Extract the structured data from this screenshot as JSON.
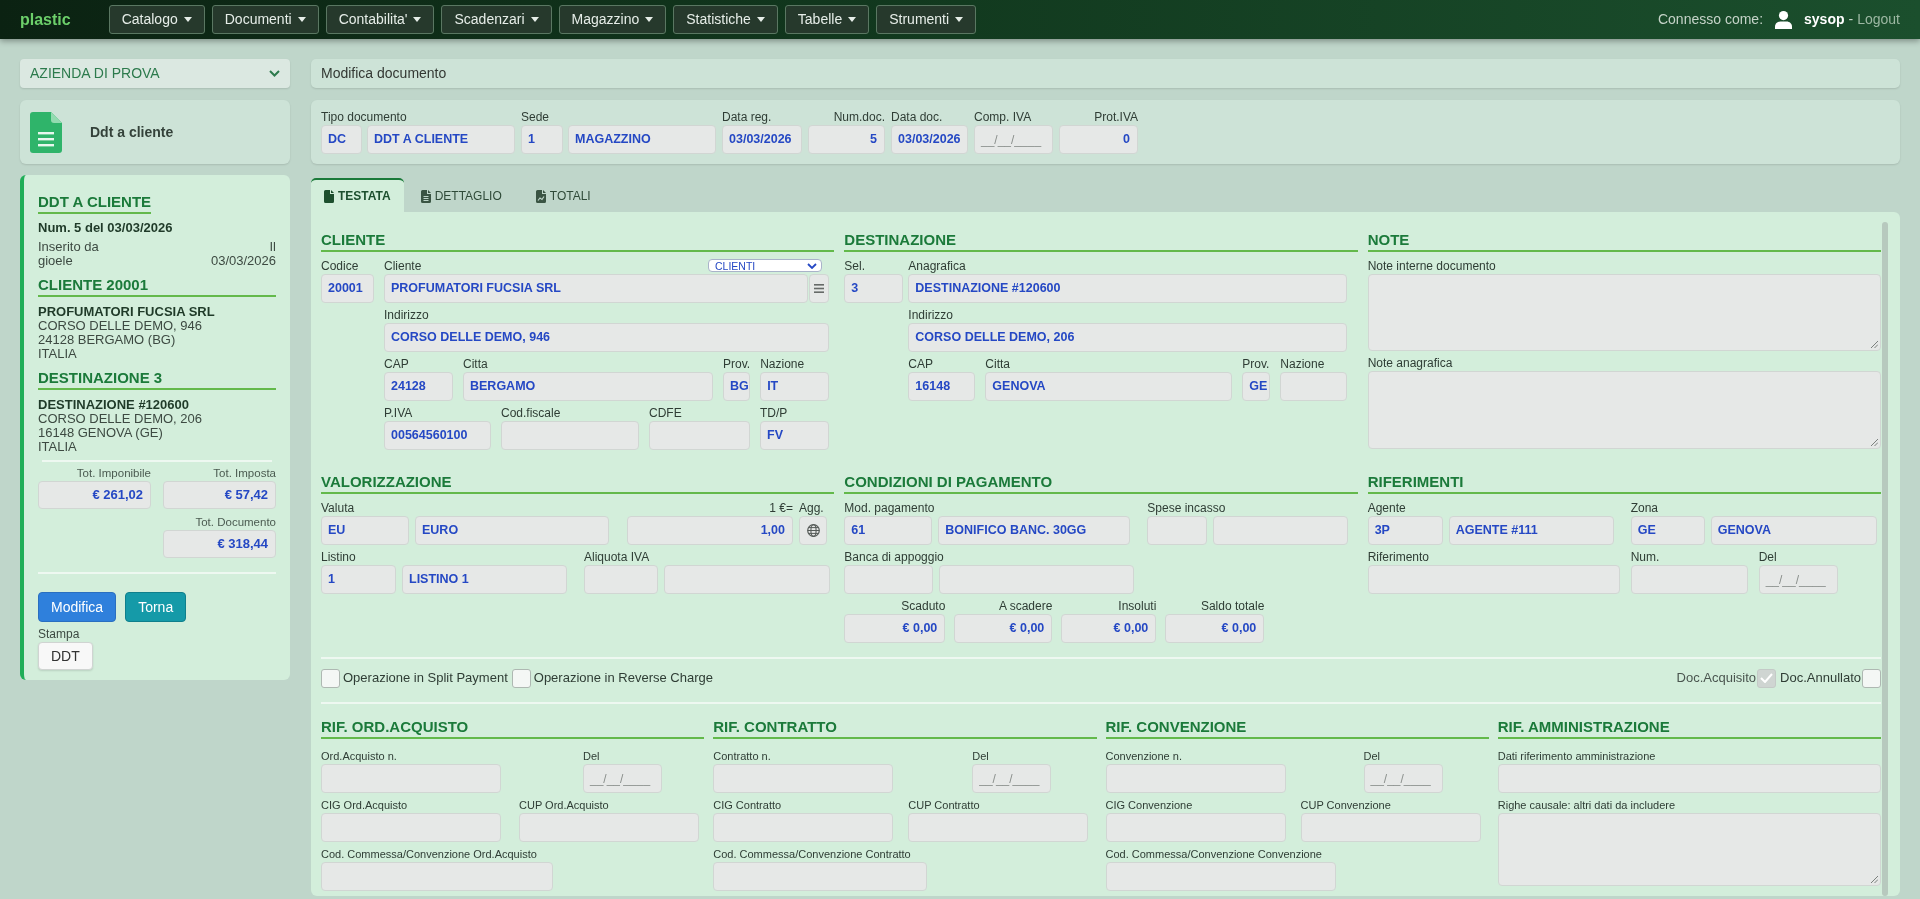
{
  "navbar": {
    "logo": "plastic",
    "menus": [
      "Catalogo",
      "Documenti",
      "Contabilita'",
      "Scadenzari",
      "Magazzino",
      "Statistiche",
      "Tabelle",
      "Strumenti"
    ],
    "user_prompt": "Connesso come:",
    "user": "sysop",
    "separator": "-",
    "logout": "Logout"
  },
  "company_select": {
    "value": "AZIENDA DI PROVA"
  },
  "document_type_card": {
    "title": "Ddt a cliente"
  },
  "summary": {
    "title": "DDT A CLIENTE",
    "number": "Num. 5 del 03/03/2026",
    "inserted_by": "Inserito da gioele",
    "inserted_on": "Il 03/03/2026",
    "sections": [
      {
        "title": "CLIENTE 20001",
        "name": "PROFUMATORI FUCSIA SRL",
        "lines": [
          "CORSO DELLE DEMO, 946",
          "24128 BERGAMO (BG)",
          "ITALIA"
        ]
      },
      {
        "title": "DESTINAZIONE 3",
        "name": "DESTINAZIONE #120600",
        "lines": [
          "CORSO DELLE DEMO, 206",
          "16148 GENOVA (GE)",
          "ITALIA"
        ]
      }
    ],
    "totals": [
      {
        "label": "Tot. Imponibile",
        "value": "€ 261,02"
      },
      {
        "label": "Tot. Imposta",
        "value": "€ 57,42"
      },
      {
        "label": "Tot. Documento",
        "value": "€ 318,44"
      }
    ],
    "buttons": [
      {
        "label": "Modifica",
        "kind": "primary"
      },
      {
        "label": "Torna",
        "kind": "info"
      }
    ],
    "print_label": "Stampa",
    "print_buttons": [
      {
        "label": "DDT"
      }
    ]
  },
  "page_title": "Modifica documento",
  "header_fields": [
    {
      "label": "Tipo documento",
      "inputs": [
        {
          "kind": "text",
          "value": "DC"
        },
        {
          "kind": "text",
          "value": "DDT A CLIENTE"
        }
      ]
    },
    {
      "label": "Sede",
      "inputs": [
        {
          "kind": "text",
          "value": "1"
        },
        {
          "kind": "text",
          "value": "MAGAZZINO"
        }
      ]
    },
    {
      "label": "Data reg.",
      "inputs": [
        {
          "kind": "date",
          "value": "03/03/2026"
        }
      ]
    },
    {
      "label": "Num.doc.",
      "inputs": [
        {
          "kind": "number",
          "value": "5"
        }
      ]
    },
    {
      "label": "Data doc.",
      "inputs": [
        {
          "kind": "date",
          "value": "03/03/2026"
        }
      ]
    },
    {
      "label": "Comp. IVA",
      "inputs": [
        {
          "kind": "date",
          "placeholder": "__/__/____"
        }
      ]
    },
    {
      "label": "Prot.IVA",
      "inputs": [
        {
          "kind": "number",
          "value": "0"
        }
      ]
    }
  ],
  "tabs": [
    {
      "label": "TESTATA",
      "selected": true
    },
    {
      "label": "DETTAGLIO",
      "selected": false
    },
    {
      "label": "TOTALI",
      "selected": false
    }
  ],
  "form": {
    "sections": [
      {
        "title": "CLIENTE",
        "fields": [
          {
            "label": "Codice",
            "inputs": [
              {
                "kind": "text",
                "value": "20001"
              }
            ]
          },
          {
            "label": "Cliente",
            "filter": {
              "value": "CLIENTI"
            },
            "inputs": [
              {
                "kind": "text",
                "value": "PROFUMATORI FUCSIA SRL"
              },
              {
                "kind": "button"
              }
            ]
          },
          {
            "label": "Indirizzo",
            "inputs": [
              {
                "kind": "text",
                "value": "CORSO DELLE DEMO, 946"
              }
            ]
          },
          {
            "label": "CAP",
            "inputs": [
              {
                "kind": "text",
                "value": "24128"
              }
            ]
          },
          {
            "label": "Citta",
            "inputs": [
              {
                "kind": "text",
                "value": "BERGAMO"
              }
            ]
          },
          {
            "label": "Prov.",
            "inputs": [
              {
                "kind": "text",
                "value": "BG"
              }
            ]
          },
          {
            "label": "Nazione",
            "inputs": [
              {
                "kind": "text",
                "value": "IT"
              }
            ]
          },
          {
            "label": "P.IVA",
            "inputs": [
              {
                "kind": "text",
                "value": "00564560100"
              }
            ]
          },
          {
            "label": "Cod.fiscale",
            "inputs": [
              {
                "kind": "text"
              }
            ]
          },
          {
            "label": "CDFE",
            "inputs": [
              {
                "kind": "text"
              }
            ]
          },
          {
            "label": "TD/P",
            "inputs": [
              {
                "kind": "text",
                "value": "FV"
              }
            ]
          }
        ]
      },
      {
        "title": "DESTINAZIONE",
        "fields": [
          {
            "label": "Sel.",
            "inputs": [
              {
                "kind": "text",
                "value": "3"
              }
            ]
          },
          {
            "label": "Anagrafica",
            "inputs": [
              {
                "kind": "text",
                "value": "DESTINAZIONE #120600"
              }
            ]
          },
          {
            "label": "Indirizzo",
            "inputs": [
              {
                "kind": "text",
                "value": "CORSO DELLE DEMO, 206"
              }
            ]
          },
          {
            "label": "CAP",
            "inputs": [
              {
                "kind": "text",
                "value": "16148"
              }
            ]
          },
          {
            "label": "Citta",
            "inputs": [
              {
                "kind": "text",
                "value": "GENOVA"
              }
            ]
          },
          {
            "label": "Prov.",
            "inputs": [
              {
                "kind": "text",
                "value": "GE"
              }
            ]
          },
          {
            "label": "Nazione",
            "inputs": [
              {
                "kind": "text"
              }
            ]
          }
        ]
      },
      {
        "title": "NOTE",
        "fields": [
          {
            "label": "Note interne documento",
            "inputs": [
              {
                "kind": "area"
              }
            ]
          },
          {
            "label": "Note anagrafica",
            "inputs": [
              {
                "kind": "area"
              }
            ]
          }
        ]
      },
      {
        "title": "VALORIZZAZIONE",
        "fields": [
          {
            "label": "Valuta",
            "inputs": [
              {
                "kind": "text",
                "value": "EU"
              },
              {
                "kind": "text",
                "value": "EURO"
              }
            ]
          },
          {
            "label": "1 €=",
            "inputs": [
              {
                "kind": "number",
                "value": "1,00"
              }
            ]
          },
          {
            "label": "Agg.",
            "inputs": [
              {
                "kind": "button"
              }
            ]
          },
          {
            "label": "Listino",
            "inputs": [
              {
                "kind": "text",
                "value": "1"
              },
              {
                "kind": "text",
                "value": "LISTINO 1"
              }
            ]
          },
          {
            "label": "Aliquota IVA",
            "inputs": [
              {
                "kind": "text"
              },
              {
                "kind": "text"
              }
            ]
          }
        ]
      },
      {
        "title": "CONDIZIONI DI PAGAMENTO",
        "fields": [
          {
            "label": "Mod. pagamento",
            "inputs": [
              {
                "kind": "text",
                "value": "61"
              },
              {
                "kind": "text",
                "value": "BONIFICO BANC. 30GG"
              }
            ]
          },
          {
            "label": "Spese incasso",
            "inputs": [
              {
                "kind": "text"
              },
              {
                "kind": "text"
              }
            ]
          },
          {
            "label": "Banca di appoggio",
            "inputs": [
              {
                "kind": "text"
              },
              {
                "kind": "text"
              }
            ]
          },
          {
            "label": "Scaduto",
            "inputs": [
              {
                "kind": "number",
                "value": "€ 0,00"
              }
            ]
          },
          {
            "label": "A scadere",
            "inputs": [
              {
                "kind": "number",
                "value": "€ 0,00"
              }
            ]
          },
          {
            "label": "Insoluti",
            "inputs": [
              {
                "kind": "number",
                "value": "€ 0,00"
              }
            ]
          },
          {
            "label": "Saldo totale",
            "inputs": [
              {
                "kind": "number",
                "value": "€ 0,00"
              }
            ]
          }
        ]
      },
      {
        "title": "RIFERIMENTI",
        "fields": [
          {
            "label": "Agente",
            "inputs": [
              {
                "kind": "text",
                "value": "3P"
              },
              {
                "kind": "text",
                "value": "AGENTE #111"
              }
            ]
          },
          {
            "label": "Zona",
            "inputs": [
              {
                "kind": "text",
                "value": "GE"
              },
              {
                "kind": "text",
                "value": "GENOVA"
              }
            ]
          },
          {
            "label": "Riferimento",
            "inputs": [
              {
                "kind": "text"
              }
            ]
          },
          {
            "label": "Num.",
            "inputs": [
              {
                "kind": "text"
              }
            ]
          },
          {
            "label": "Del",
            "inputs": [
              {
                "kind": "date",
                "placeholder": "__/__/____"
              }
            ]
          }
        ]
      }
    ],
    "checkboxes": [
      {
        "label": "Operazione in Split Payment",
        "checked": false,
        "disabled": false
      },
      {
        "label": "Operazione in Reverse Charge",
        "checked": false,
        "disabled": false
      },
      {
        "label": "Doc.Acquisito",
        "checked": true,
        "disabled": true
      },
      {
        "label": "Doc.Annullato",
        "checked": false,
        "disabled": false
      }
    ],
    "reference_sections": [
      {
        "title": "RIF. ORD.ACQUISTO",
        "fields": [
          {
            "label": "Ord.Acquisto n.",
            "inputs": [
              {
                "kind": "text"
              }
            ]
          },
          {
            "label": "Del",
            "inputs": [
              {
                "kind": "date",
                "placeholder": "__/__/____"
              }
            ]
          },
          {
            "label": "CIG Ord.Acquisto",
            "inputs": [
              {
                "kind": "text"
              }
            ]
          },
          {
            "label": "CUP Ord.Acquisto",
            "inputs": [
              {
                "kind": "text"
              }
            ]
          },
          {
            "label": "Cod. Commessa/Convenzione Ord.Acquisto",
            "inputs": [
              {
                "kind": "text"
              }
            ]
          }
        ]
      },
      {
        "title": "RIF. CONTRATTO",
        "fields": [
          {
            "label": "Contratto n.",
            "inputs": [
              {
                "kind": "text"
              }
            ]
          },
          {
            "label": "Del",
            "inputs": [
              {
                "kind": "date",
                "placeholder": "__/__/____"
              }
            ]
          },
          {
            "label": "CIG Contratto",
            "inputs": [
              {
                "kind": "text"
              }
            ]
          },
          {
            "label": "CUP Contratto",
            "inputs": [
              {
                "kind": "text"
              }
            ]
          },
          {
            "label": "Cod. Commessa/Convenzione Contratto",
            "inputs": [
              {
                "kind": "text"
              }
            ]
          }
        ]
      },
      {
        "title": "RIF. CONVENZIONE",
        "fields": [
          {
            "label": "Convenzione n.",
            "inputs": [
              {
                "kind": "text"
              }
            ]
          },
          {
            "label": "Del",
            "inputs": [
              {
                "kind": "date",
                "placeholder": "__/__/____"
              }
            ]
          },
          {
            "label": "CIG Convenzione",
            "inputs": [
              {
                "kind": "text"
              }
            ]
          },
          {
            "label": "CUP Convenzione",
            "inputs": [
              {
                "kind": "text"
              }
            ]
          },
          {
            "label": "Cod. Commessa/Convenzione Convenzione",
            "inputs": [
              {
                "kind": "text"
              }
            ]
          }
        ]
      },
      {
        "title": "RIF. AMMINISTRAZIONE",
        "fields": [
          {
            "label": "Dati riferimento amministrazione",
            "inputs": [
              {
                "kind": "text"
              }
            ]
          },
          {
            "label": "Righe causale: altri dati da includere",
            "inputs": [
              {
                "kind": "area"
              }
            ]
          }
        ]
      }
    ]
  }
}
